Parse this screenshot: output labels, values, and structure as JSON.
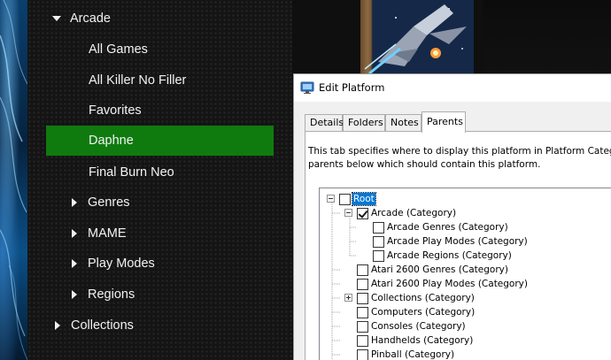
{
  "sidebar": {
    "items": [
      {
        "label": "Arcade",
        "caret": "down"
      },
      {
        "label": "All Games"
      },
      {
        "label": "All Killer No Filler"
      },
      {
        "label": "Favorites"
      },
      {
        "label": "Daphne",
        "selected": true
      },
      {
        "label": "Final Burn Neo"
      },
      {
        "label": "Genres",
        "caret": "right"
      },
      {
        "label": "MAME",
        "caret": "right"
      },
      {
        "label": "Play Modes",
        "caret": "right"
      },
      {
        "label": "Regions",
        "caret": "right"
      },
      {
        "label": "Collections",
        "caret": "right"
      }
    ]
  },
  "dialog": {
    "title": "Edit Platform",
    "icon": "monitor-icon",
    "tabs": [
      {
        "label": "Details"
      },
      {
        "label": "Folders"
      },
      {
        "label": "Notes"
      },
      {
        "label": "Parents",
        "active": true
      }
    ],
    "description_line1": "This tab specifies where to display this platform in Platform Categorie",
    "description_line2": "parents below which should contain this platform.",
    "tree": [
      {
        "label": "Root",
        "checked": false,
        "selected": true,
        "expander": "minus"
      },
      {
        "label": "Arcade (Category)",
        "checked": true,
        "expander": "minus"
      },
      {
        "label": "Arcade Genres (Category)",
        "checked": false
      },
      {
        "label": "Arcade Play Modes (Category)",
        "checked": false
      },
      {
        "label": "Arcade Regions (Category)",
        "checked": false
      },
      {
        "label": "Atari 2600 Genres (Category)",
        "checked": false
      },
      {
        "label": "Atari 2600 Play Modes (Category)",
        "checked": false
      },
      {
        "label": "Collections (Category)",
        "checked": false,
        "expander": "plus"
      },
      {
        "label": "Computers (Category)",
        "checked": false
      },
      {
        "label": "Consoles (Category)",
        "checked": false
      },
      {
        "label": "Handhelds (Category)",
        "checked": false
      },
      {
        "label": "Pinball (Category)",
        "checked": false
      }
    ]
  },
  "colors": {
    "selected_item_bg": "#0f7b0f",
    "tree_selection": "#0078d7"
  }
}
